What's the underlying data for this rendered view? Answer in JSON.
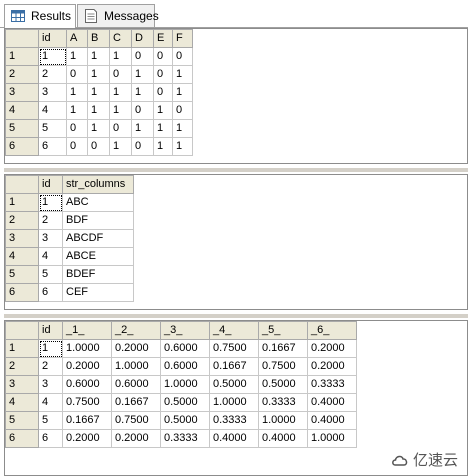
{
  "tabs": [
    {
      "label": "Results",
      "icon": "results-grid-icon"
    },
    {
      "label": "Messages",
      "icon": "messages-icon"
    }
  ],
  "grid1": {
    "columns": [
      "id",
      "A",
      "B",
      "C",
      "D",
      "E",
      "F"
    ],
    "rows": [
      [
        "1",
        "1",
        "1",
        "1",
        "0",
        "0",
        "0"
      ],
      [
        "2",
        "0",
        "1",
        "0",
        "1",
        "0",
        "1"
      ],
      [
        "3",
        "1",
        "1",
        "1",
        "1",
        "0",
        "1"
      ],
      [
        "4",
        "1",
        "1",
        "1",
        "0",
        "1",
        "0"
      ],
      [
        "5",
        "0",
        "1",
        "0",
        "1",
        "1",
        "1"
      ],
      [
        "6",
        "0",
        "0",
        "1",
        "0",
        "1",
        "1"
      ]
    ]
  },
  "grid2": {
    "columns": [
      "id",
      "str_columns"
    ],
    "rows": [
      [
        "1",
        "ABC"
      ],
      [
        "2",
        "BDF"
      ],
      [
        "3",
        "ABCDF"
      ],
      [
        "4",
        "ABCE"
      ],
      [
        "5",
        "BDEF"
      ],
      [
        "6",
        "CEF"
      ]
    ]
  },
  "grid3": {
    "columns": [
      "id",
      "_1_",
      "_2_",
      "_3_",
      "_4_",
      "_5_",
      "_6_"
    ],
    "rows": [
      [
        "1",
        "1.0000",
        "0.2000",
        "0.6000",
        "0.7500",
        "0.1667",
        "0.2000"
      ],
      [
        "2",
        "0.2000",
        "1.0000",
        "0.6000",
        "0.1667",
        "0.7500",
        "0.2000"
      ],
      [
        "3",
        "0.6000",
        "0.6000",
        "1.0000",
        "0.5000",
        "0.5000",
        "0.3333"
      ],
      [
        "4",
        "0.7500",
        "0.1667",
        "0.5000",
        "1.0000",
        "0.3333",
        "0.4000"
      ],
      [
        "5",
        "0.1667",
        "0.7500",
        "0.5000",
        "0.3333",
        "1.0000",
        "0.4000"
      ],
      [
        "6",
        "0.2000",
        "0.2000",
        "0.3333",
        "0.4000",
        "0.4000",
        "1.0000"
      ]
    ]
  },
  "watermark": {
    "text": "亿速云"
  }
}
